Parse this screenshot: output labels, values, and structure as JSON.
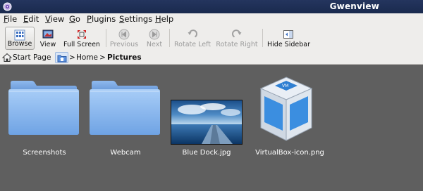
{
  "window": {
    "title": "Gwenview"
  },
  "menu": [
    {
      "label": "File",
      "key": "F",
      "rest": "ile"
    },
    {
      "label": "Edit",
      "key": "E",
      "rest": "dit"
    },
    {
      "label": "View",
      "key": "V",
      "rest": "iew"
    },
    {
      "label": "Go",
      "key": "G",
      "rest": "o"
    },
    {
      "label": "Plugins",
      "key": "P",
      "rest": "lugins"
    },
    {
      "label": "Settings",
      "key": "S",
      "rest": "ettings"
    },
    {
      "label": "Help",
      "key": "H",
      "rest": "elp"
    }
  ],
  "toolbar": {
    "browse": "Browse",
    "view": "View",
    "full_screen": "Full Screen",
    "previous": "Previous",
    "next": "Next",
    "rotate_left": "Rotate Left",
    "rotate_right": "Rotate Right",
    "hide_sidebar": "Hide Sidebar"
  },
  "breadcrumb": {
    "start_page": "Start Page",
    "sep1": ">",
    "home": "Home",
    "sep2": ">",
    "current": "Pictures"
  },
  "items": [
    {
      "name": "Screenshots",
      "type": "folder"
    },
    {
      "name": "Webcam",
      "type": "folder"
    },
    {
      "name": "Blue Dock.jpg",
      "type": "image"
    },
    {
      "name": "VirtualBox-icon.png",
      "type": "image"
    }
  ],
  "colors": {
    "titlebar": "#1f2f56",
    "chrome": "#eeedeb",
    "viewport": "#5f5f5f",
    "folder": "#7fb0ec"
  }
}
